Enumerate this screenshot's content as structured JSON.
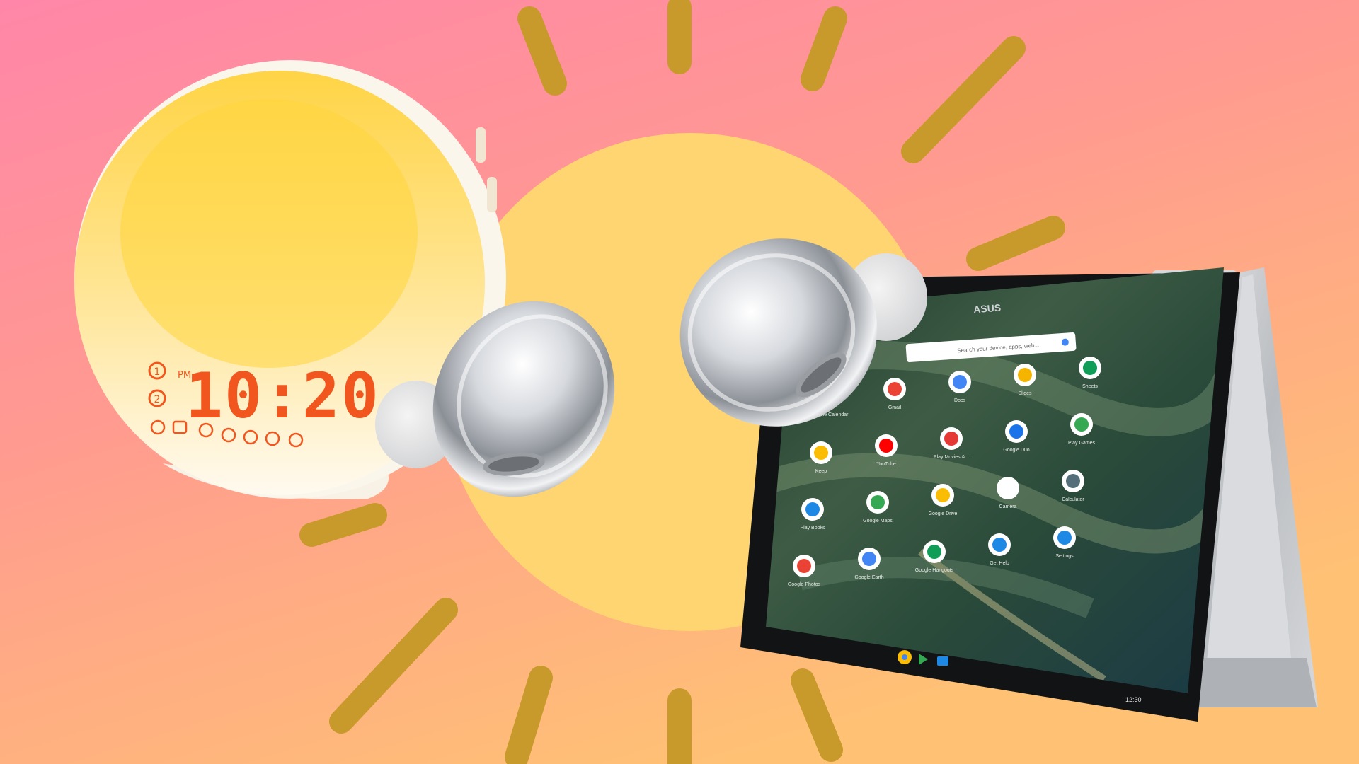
{
  "colors": {
    "bg_top_left": "#ff86a8",
    "bg_mid": "#ff9a90",
    "bg_bottom": "#ffc274",
    "sun": "#ffd572",
    "rays": "#c79a2b",
    "clock_glow": "#ffd64a",
    "clock_display": "#f2561f",
    "laptop_body": "#c7c9cc",
    "laptop_screen": "#23402f"
  },
  "clock": {
    "time": "10:20",
    "pm_label": "PM",
    "alarm_1": "1",
    "alarm_2": "2"
  },
  "laptop": {
    "brand": "ASUS",
    "search_placeholder": "Search your device, apps, web...",
    "status_time": "12:30",
    "shortcuts": [
      "Google Calendar",
      "Play Movies & TV",
      "Play Store",
      "Google Maps"
    ],
    "apps": [
      {
        "icon": "google-calendar-icon",
        "label": "Google Calendar",
        "color": "#4285f4"
      },
      {
        "icon": "gmail-icon",
        "label": "Gmail",
        "color": "#ea4335"
      },
      {
        "icon": "docs-icon",
        "label": "Docs",
        "color": "#4285f4"
      },
      {
        "icon": "slides-icon",
        "label": "Slides",
        "color": "#f4b400"
      },
      {
        "icon": "sheets-icon",
        "label": "Sheets",
        "color": "#0f9d58"
      },
      {
        "icon": "keep-icon",
        "label": "Keep",
        "color": "#fbbc04"
      },
      {
        "icon": "youtube-icon",
        "label": "YouTube",
        "color": "#ff0000"
      },
      {
        "icon": "play-movies-icon",
        "label": "Play Movies &...",
        "color": "#e53935"
      },
      {
        "icon": "google-duo-icon",
        "label": "Google Duo",
        "color": "#1a73e8"
      },
      {
        "icon": "play-games-icon",
        "label": "Play Games",
        "color": "#34a853"
      },
      {
        "icon": "play-books-icon",
        "label": "Play Books",
        "color": "#1e88e5"
      },
      {
        "icon": "google-maps-icon",
        "label": "Google Maps",
        "color": "#34a853"
      },
      {
        "icon": "google-drive-icon",
        "label": "Google Drive",
        "color": "#fbbc04"
      },
      {
        "icon": "camera-icon",
        "label": "Camera",
        "color": "#ffffff"
      },
      {
        "icon": "calculator-icon",
        "label": "Calculator",
        "color": "#546e7a"
      },
      {
        "icon": "google-photos-icon",
        "label": "Google Photos",
        "color": "#ea4335"
      },
      {
        "icon": "google-earth-icon",
        "label": "Google Earth",
        "color": "#4285f4"
      },
      {
        "icon": "hangouts-icon",
        "label": "Google Hangouts",
        "color": "#0f9d58"
      },
      {
        "icon": "get-help-icon",
        "label": "Get Help",
        "color": "#1e88e5"
      },
      {
        "icon": "settings-icon",
        "label": "Settings",
        "color": "#1e88e5"
      }
    ],
    "shelf": [
      "chrome-icon",
      "play-store-icon",
      "files-icon"
    ]
  }
}
